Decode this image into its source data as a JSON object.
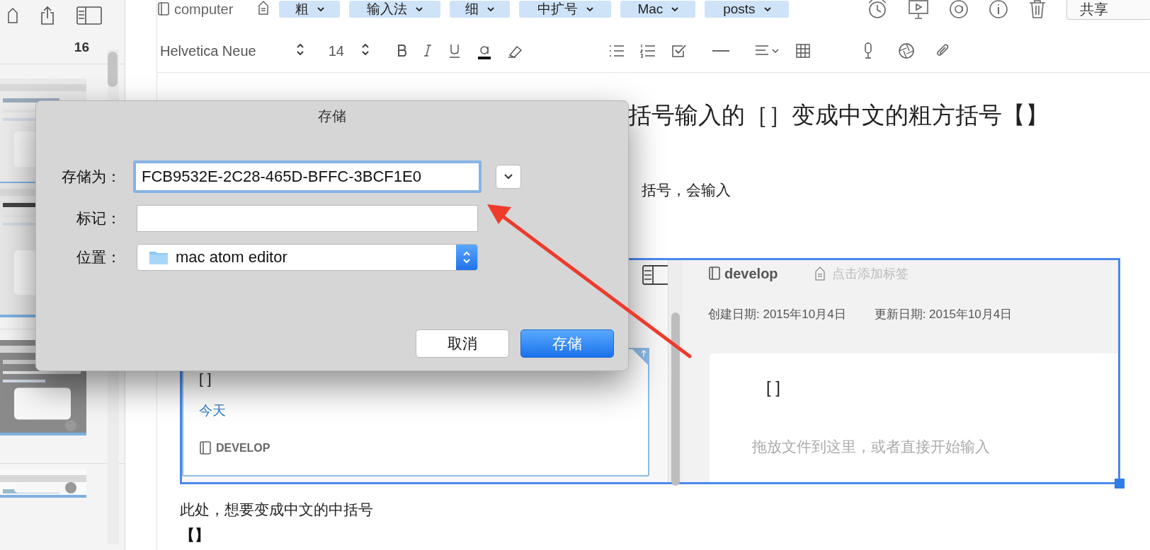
{
  "sidebar": {
    "count": "16"
  },
  "toolbar": {
    "notebook": "computer",
    "tags": [
      "粗",
      "输入法",
      "细",
      "中扩号",
      "Mac",
      "posts"
    ],
    "share_button": "共享"
  },
  "format_bar": {
    "font": "Helvetica Neue",
    "size": "14"
  },
  "note": {
    "heading": "括号输入的［］变成中文的粗方括号【】",
    "line_1": "括号，会输入",
    "embedded_screenshot": {
      "card": {
        "text": "[ ]",
        "date": "今天",
        "notebook_badge": "DEVELOP",
        "selected": true
      },
      "notebook": "develop",
      "tag_placeholder": "点击添加标签",
      "created": "创建日期: 2015年10月4日",
      "updated": "更新日期: 2015年10月4日",
      "editor_text": "[ ]",
      "editor_placeholder": "拖放文件到这里，或者直接开始输入"
    },
    "line_2": "此处，想要变成中文的中括号",
    "line_3": "【】"
  },
  "dialog": {
    "title": "存储",
    "fields": [
      {
        "kind": "text",
        "label": "存储为：",
        "value": "FCB9532E-2C28-465D-BFFC-3BCF1E0",
        "focused": true
      },
      {
        "kind": "text",
        "label": "标记：",
        "focused": false
      },
      {
        "kind": "popup",
        "label": "位置：",
        "value": "mac atom editor",
        "focused": false
      }
    ],
    "buttons": [
      {
        "label": "取消",
        "default": false
      },
      {
        "label": "存储",
        "default": true
      }
    ]
  }
}
